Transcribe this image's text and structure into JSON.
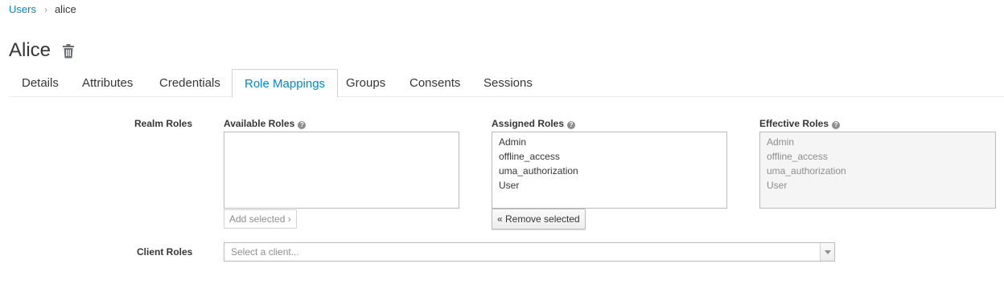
{
  "breadcrumb": {
    "parent": "Users",
    "separator": "›",
    "current": "alice"
  },
  "page": {
    "title": "Alice"
  },
  "tabs": [
    {
      "label": "Details"
    },
    {
      "label": "Attributes"
    },
    {
      "label": "Credentials"
    },
    {
      "label": "Role Mappings",
      "active": true
    },
    {
      "label": "Groups"
    },
    {
      "label": "Consents"
    },
    {
      "label": "Sessions"
    }
  ],
  "realm_roles": {
    "label": "Realm Roles",
    "available": {
      "label": "Available Roles",
      "help": "?",
      "items": []
    },
    "assigned": {
      "label": "Assigned Roles",
      "help": "?",
      "items": [
        "Admin",
        "offline_access",
        "uma_authorization",
        "User"
      ]
    },
    "effective": {
      "label": "Effective Roles",
      "help": "?",
      "items": [
        "Admin",
        "offline_access",
        "uma_authorization",
        "User"
      ]
    },
    "add_button": "Add selected ›",
    "remove_button": "« Remove selected"
  },
  "client_roles": {
    "label": "Client Roles",
    "placeholder": "Select a client..."
  },
  "colors": {
    "link": "#0088ce",
    "text": "#363636",
    "muted": "#8b8d8f"
  }
}
